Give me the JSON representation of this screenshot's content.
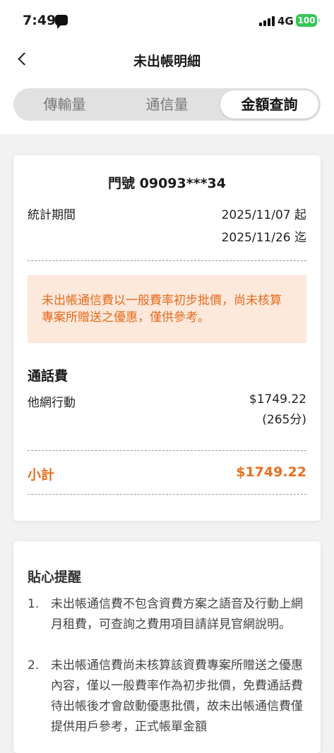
{
  "status_bar": {
    "time": "7:49",
    "network": "4G",
    "battery": "100"
  },
  "header": {
    "title": "未出帳明細"
  },
  "tabs": [
    {
      "label": "傳輸量"
    },
    {
      "label": "通信量"
    },
    {
      "label": "金額查詢"
    }
  ],
  "summary": {
    "line_number": "門號 09093***34",
    "period_label": "統計期間",
    "period_start": "2025/11/07 起",
    "period_end": "2025/11/26 迄",
    "notice": "未出帳通信費以一般費率初步批價，尚未核算專案所贈送之優惠，僅供參考。",
    "section_title": "通話費",
    "item_label": "他網行動",
    "item_amount": "$1749.22",
    "item_minutes": "(265分)",
    "subtotal_label": "小計",
    "subtotal_amount": "$1749.22"
  },
  "tips": {
    "title": "貼心提醒",
    "items": [
      {
        "no": "1.",
        "text": "未出帳通信費不包含資費方案之語音及行動上網月租費，可查詢之費用項目請詳見官網說明。"
      },
      {
        "no": "2.",
        "text": "未出帳通信費尚未核算該資費專案所贈送之優惠內容，僅以一般費率作為初步批價，免費通話費待出帳後才會啟動優惠批價，故未出帳通信費僅提供用戶參考，正式帳單金額"
      }
    ]
  },
  "colors": {
    "accent": "#e8701e",
    "notice_bg": "#fde8dc"
  }
}
